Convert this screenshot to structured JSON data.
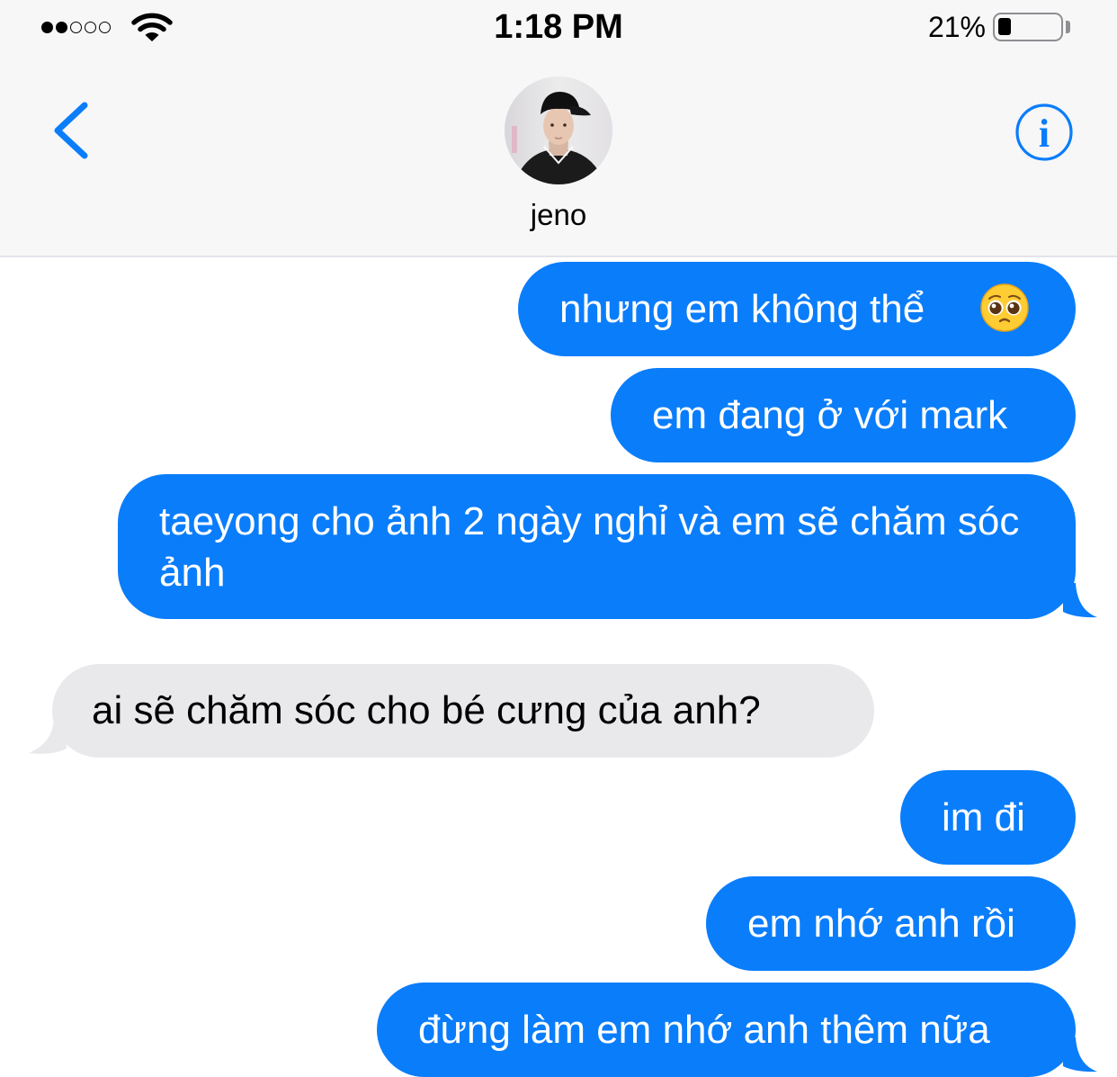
{
  "status_bar": {
    "signal_bars": 2,
    "signal_total": 5,
    "time": "1:18 PM",
    "battery_percent_label": "21%",
    "battery_level": 0.21
  },
  "nav": {
    "back_icon": "chevron-left-icon",
    "contact_name": "jeno",
    "info_icon": "info-icon"
  },
  "colors": {
    "accent": "#0a7dfb",
    "outgoing_bubble": "#0a7dfb",
    "incoming_bubble": "#e9e9ec",
    "nav_background": "#f7f7f7"
  },
  "messages": [
    {
      "direction": "outgoing",
      "text": "nhưng em không thể",
      "emoji": "pleading-face-icon"
    },
    {
      "direction": "outgoing",
      "text": "em đang ở với mark"
    },
    {
      "direction": "outgoing",
      "text": "taeyong cho ảnh 2 ngày nghỉ và em sẽ chăm sóc ảnh"
    },
    {
      "direction": "incoming",
      "text": "ai sẽ chăm sóc cho bé cưng của anh?"
    },
    {
      "direction": "outgoing",
      "text": "im đi"
    },
    {
      "direction": "outgoing",
      "text": "em nhớ anh rồi"
    },
    {
      "direction": "outgoing",
      "text": "đừng làm em nhớ anh thêm nữa"
    }
  ]
}
